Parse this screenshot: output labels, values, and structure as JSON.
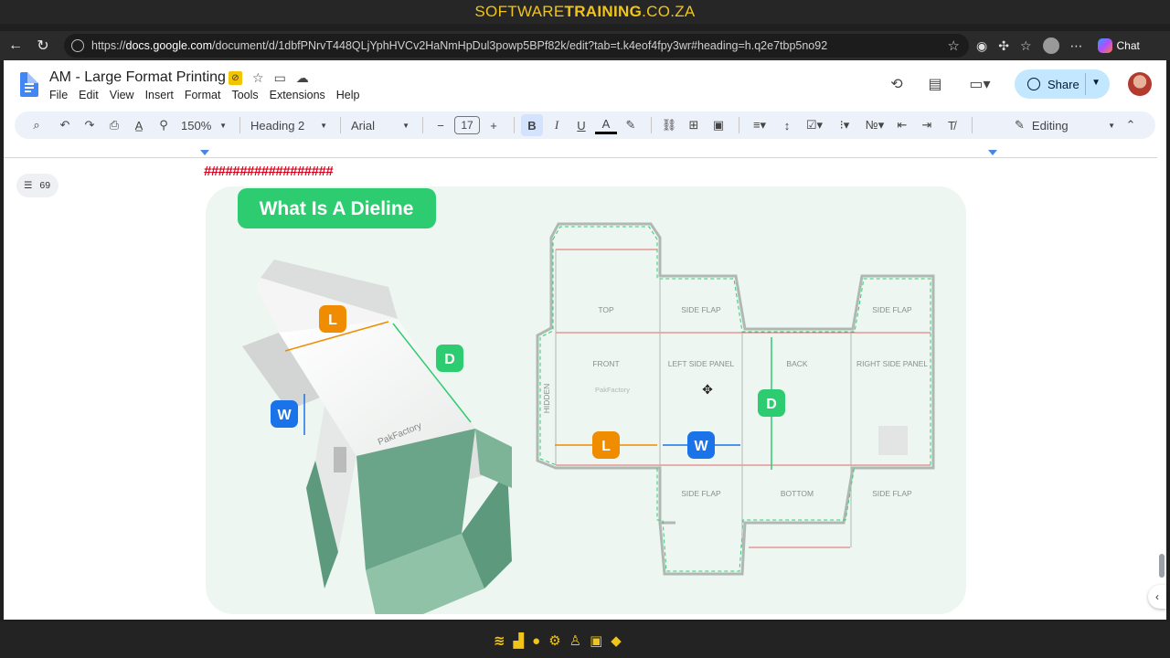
{
  "banner": {
    "prefix": "SOFTWARE",
    "bold": "TRAINING",
    "suffix": ".CO.ZA"
  },
  "browser": {
    "url_domain": "docs.google.com",
    "url_rest": "/document/d/1dbfPNrvT448QLjYphHVCv2HaNmHpDul3powp5BPf82k/edit?tab=t.k4eof4fpy3wr#heading=h.q2e7tbp5no92",
    "url_prefix": "https://",
    "chat_label": "Chat"
  },
  "doc": {
    "title": "AM - Large Format Printing",
    "menu": [
      "File",
      "Edit",
      "View",
      "Insert",
      "Format",
      "Tools",
      "Extensions",
      "Help"
    ],
    "share_label": "Share"
  },
  "toolbar": {
    "zoom": "150%",
    "style": "Heading 2",
    "font": "Arial",
    "font_size": "17",
    "mode": "Editing"
  },
  "outline": {
    "count": "69"
  },
  "content": {
    "hashes": "##################",
    "image": {
      "badge_title": "What Is A Dieline",
      "box_brand": "PakFactory",
      "dims": {
        "L": "L",
        "W": "W",
        "D": "D"
      },
      "panels": {
        "top": "TOP",
        "side_flap": "SIDE FLAP",
        "front": "FRONT",
        "left_side_panel": "LEFT SIDE PANEL",
        "back": "BACK",
        "right_side_panel": "RIGHT SIDE PANEL",
        "bottom": "BOTTOM",
        "hidden": "HIDDEN",
        "brand_small": "PakFactory"
      }
    }
  },
  "colors": {
    "accent_green": "#2ecc71",
    "orange": "#f08c00",
    "blue": "#1a73e8",
    "dieline_red": "#e06666"
  }
}
